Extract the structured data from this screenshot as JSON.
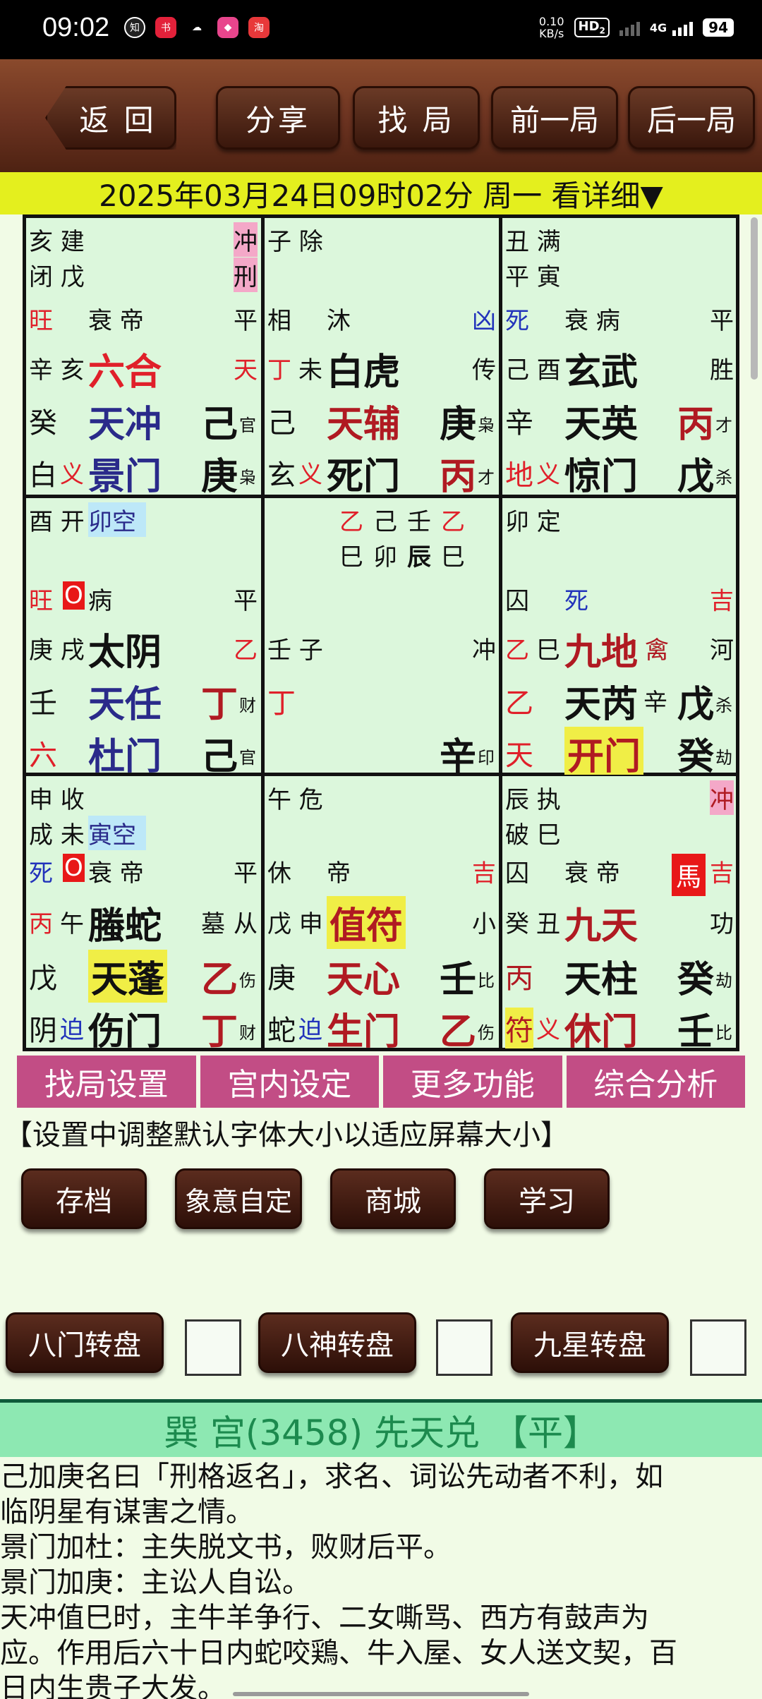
{
  "status_bar": {
    "time": "09:02",
    "net_speed": "0.10",
    "net_unit": "KB/s",
    "hd": "HD",
    "hd_sub": "2",
    "network": "4G",
    "battery": "94"
  },
  "toolbar": {
    "back": "返 回",
    "share": "分享",
    "find": "找 局",
    "prev": "前一局",
    "next": "后一局"
  },
  "date_bar": "2025年03月24日09时02分 周一 看详细▼",
  "grid": {
    "c1": {
      "r1a": "亥 建",
      "r1b": "冲",
      "r2a": "闭 戊",
      "r2b": "刑",
      "r3a": "旺",
      "r3b": "衰 帝",
      "r3c": "平",
      "r4a": "辛 亥",
      "r4b": "六合",
      "r4c": "天",
      "r5a": "癸",
      "r5b": "天冲",
      "r5c": "己",
      "r5d": "官",
      "r6a": "白",
      "r6b": "义",
      "r6c": "景门",
      "r6d": "庚",
      "r6e": "枭"
    },
    "c2": {
      "r1a": "子 除",
      "r3a": "相",
      "r3b": "沐",
      "r3c": "凶",
      "r4a": "丁",
      "r4b": "未",
      "r4c": "白虎",
      "r4d": "传",
      "r5a": "己",
      "r5b": "天辅",
      "r5c": "庚",
      "r5d": "枭",
      "r6a": "玄",
      "r6b": "义",
      "r6c": "死门",
      "r6d": "丙",
      "r6e": "才"
    },
    "c3": {
      "r1a": "丑 满",
      "r2a": "平 寅",
      "r3a": "死",
      "r3b": "衰 病",
      "r3c": "平",
      "r4a": "己 酉",
      "r4b": "玄武",
      "r4c": "胜",
      "r5a": "辛",
      "r5b": "天英",
      "r5c": "丙",
      "r5d": "才",
      "r6a": "地",
      "r6b": "义",
      "r6c": "惊门",
      "r6d": "戊",
      "r6e": "杀"
    },
    "c4": {
      "r1a": "酉 开",
      "r1b": "卯空",
      "r3a": "旺",
      "r3b": "O",
      "r3c": "病",
      "r3d": "平",
      "r4a": "庚 戌",
      "r4b": "太阴",
      "r4c": "乙",
      "r5a": "壬",
      "r5b": "天任",
      "r5c": "丁",
      "r5d": "财",
      "r6a": "六",
      "r6b": "杜门",
      "r6c": "己",
      "r6d": "官"
    },
    "c5": {
      "r1a": "乙",
      "r1b": "己",
      "r1c": "壬",
      "r1d": "乙",
      "r2a": "巳",
      "r2b": "卯",
      "r2c": "辰",
      "r2d": "巳",
      "r4a": "壬 子",
      "r4b": "冲",
      "r5a": "丁",
      "r6a": "辛",
      "r6b": "印"
    },
    "c6": {
      "r1a": "卯 定",
      "r3a": "囚",
      "r3b": "死",
      "r3c": "吉",
      "r4a": "乙",
      "r4b": "巳",
      "r4c": "九地",
      "r4d": "禽",
      "r4e": "河",
      "r5a": "乙",
      "r5b": "天芮",
      "r5c": "辛",
      "r5d": "戊",
      "r5e": "杀",
      "r6a": "天",
      "r6b": "开门",
      "r6c": "癸",
      "r6d": "劫"
    },
    "c7": {
      "r1a": "申 收",
      "r2a": "成 未",
      "r2b": "寅空",
      "r3a": "死",
      "r3b": "O",
      "r3c": "衰 帝",
      "r3d": "平",
      "r4a": "丙",
      "r4b": "午",
      "r4c": "螣蛇",
      "r4d": "墓",
      "r4e": "从",
      "r5a": "戊",
      "r5b": "天蓬",
      "r5c": "乙",
      "r5d": "伤",
      "r6a": "阴",
      "r6b": "迫",
      "r6c": "伤门",
      "r6d": "丁",
      "r6e": "财"
    },
    "c8": {
      "r1a": "午 危",
      "r3a": "休",
      "r3b": "帝",
      "r3c": "吉",
      "r4a": "戊 申",
      "r4b": "值符",
      "r4c": "小",
      "r5a": "庚",
      "r5b": "天心",
      "r5c": "壬",
      "r5d": "比",
      "r6a": "蛇",
      "r6b": "迫",
      "r6c": "生门",
      "r6d": "乙",
      "r6e": "伤"
    },
    "c9": {
      "r1a": "辰 执",
      "r1b": "冲",
      "r2a": "破 巳",
      "r3a": "囚",
      "r3b": "衰 帝",
      "r3c": "馬",
      "r3d": "吉",
      "r4a": "癸",
      "r4b": "丑",
      "r4c": "九天",
      "r4d": "功",
      "r5a": "丙",
      "r5b": "天柱",
      "r5c": "癸",
      "r5d": "劫",
      "r6a": "符",
      "r6b": "义",
      "r6c": "休门",
      "r6d": "壬",
      "r6e": "比"
    }
  },
  "tabs": [
    "找局设置",
    "宫内设定",
    "更多功能",
    "综合分析"
  ],
  "hint": "【设置中调整默认字体大小以适应屏幕大小】",
  "buttons": {
    "save": "存档",
    "custom": "象意自定",
    "shop": "商城",
    "learn": "学习"
  },
  "rotate": {
    "door": "八门转盘",
    "god": "八神转盘",
    "star": "九星转盘"
  },
  "palace": {
    "name": "巽 宫(3458) 先天兑",
    "level": "【平】"
  },
  "description": [
    "己加庚名曰「刑格返名」，求名、词讼先动者不利，如",
    "临阴星有谋害之情。",
    "景门加杜：主失脱文书，败财后平。",
    "景门加庚：主讼人自讼。",
    "天冲值巳时，主牛羊争行、二女嘶骂、西方有鼓声为",
    "应。作用后六十日内蛇咬鶏、牛入屋、女人送文契，百",
    "日内生贵子大发。"
  ]
}
